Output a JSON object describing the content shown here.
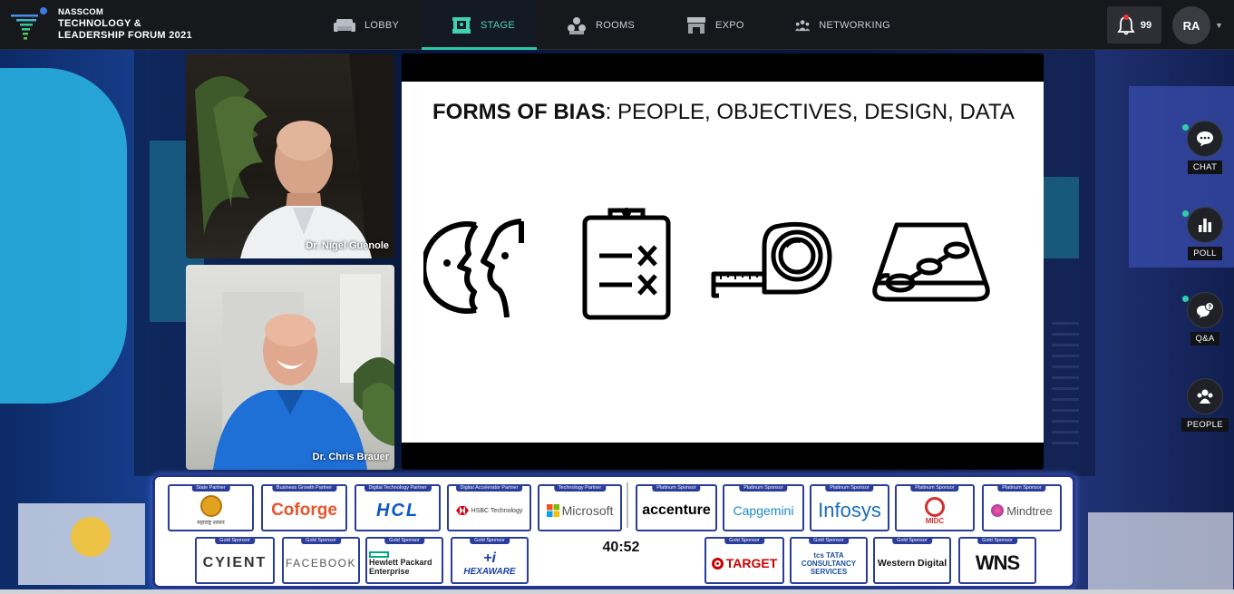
{
  "brand": {
    "line1": "NASSCOM",
    "line2": "TECHNOLOGY &",
    "line3": "LEADERSHIP FORUM 2021"
  },
  "nav": {
    "items": [
      {
        "label": "LOBBY",
        "icon": "sofa-icon"
      },
      {
        "label": "STAGE",
        "icon": "stage-icon"
      },
      {
        "label": "ROOMS",
        "icon": "rooms-icon"
      },
      {
        "label": "EXPO",
        "icon": "expo-icon"
      },
      {
        "label": "NETWORKING",
        "icon": "networking-icon"
      }
    ],
    "active": "STAGE"
  },
  "notifications": {
    "count": "99",
    "icon": "bell-icon"
  },
  "user": {
    "initials": "RA"
  },
  "speakers": [
    {
      "name": "Dr. Nigel Guenole"
    },
    {
      "name": "Dr. Chris Brauer"
    }
  ],
  "slide": {
    "title_bold": "FORMS OF BIAS",
    "title_rest": ": PEOPLE, OBJECTIVES, DESIGN, DATA",
    "icons": [
      "faces-icon",
      "clipboard-checklist-icon",
      "tape-measure-icon",
      "data-scroll-icon"
    ]
  },
  "tools": [
    {
      "label": "CHAT",
      "icon": "chat-icon"
    },
    {
      "label": "POLL",
      "icon": "poll-icon"
    },
    {
      "label": "Q&A",
      "icon": "qa-icon"
    },
    {
      "label": "PEOPLE",
      "icon": "people-icon"
    }
  ],
  "sponsors": {
    "row1": [
      {
        "tag": "State Partner",
        "logo": "महाराष्ट्र शासन"
      },
      {
        "tag": "Business Growth Partner",
        "logo": "Coforge"
      },
      {
        "tag": "Digital Technology Partner",
        "logo": "HCL"
      },
      {
        "tag": "Digital Accelerator Partner",
        "logo": "HSBC Technology"
      },
      {
        "tag": "Technology Partner",
        "logo": "Microsoft"
      },
      {
        "tag": "Platinum Sponsor",
        "logo": "accenture"
      },
      {
        "tag": "Platinum Sponsor",
        "logo": "Capgemini"
      },
      {
        "tag": "Platinum Sponsor",
        "logo": "Infosys"
      },
      {
        "tag": "Platinum Sponsor",
        "logo": "MIDC"
      },
      {
        "tag": "Platinum Sponsor",
        "logo": "Mindtree"
      }
    ],
    "row2": [
      {
        "tag": "Gold Sponsor",
        "logo": "CYIENT"
      },
      {
        "tag": "Gold Sponsor",
        "logo": "FACEBOOK"
      },
      {
        "tag": "Gold Sponsor",
        "logo": "Hewlett Packard Enterprise"
      },
      {
        "tag": "Gold Sponsor",
        "logo": "HEXAWARE"
      },
      {
        "tag": "Gold Sponsor",
        "logo": "TARGET"
      },
      {
        "tag": "Gold Sponsor",
        "logo": "tcs TATA CONSULTANCY SERVICES"
      },
      {
        "tag": "Gold Sponsor",
        "logo": "Western Digital"
      },
      {
        "tag": "Gold Sponsor",
        "logo": "WNS"
      }
    ]
  },
  "timer": "40:52",
  "colors": {
    "accent": "#2fc6a8",
    "sponsor_border": "#2a3d9a",
    "topbar": "#17181c"
  }
}
